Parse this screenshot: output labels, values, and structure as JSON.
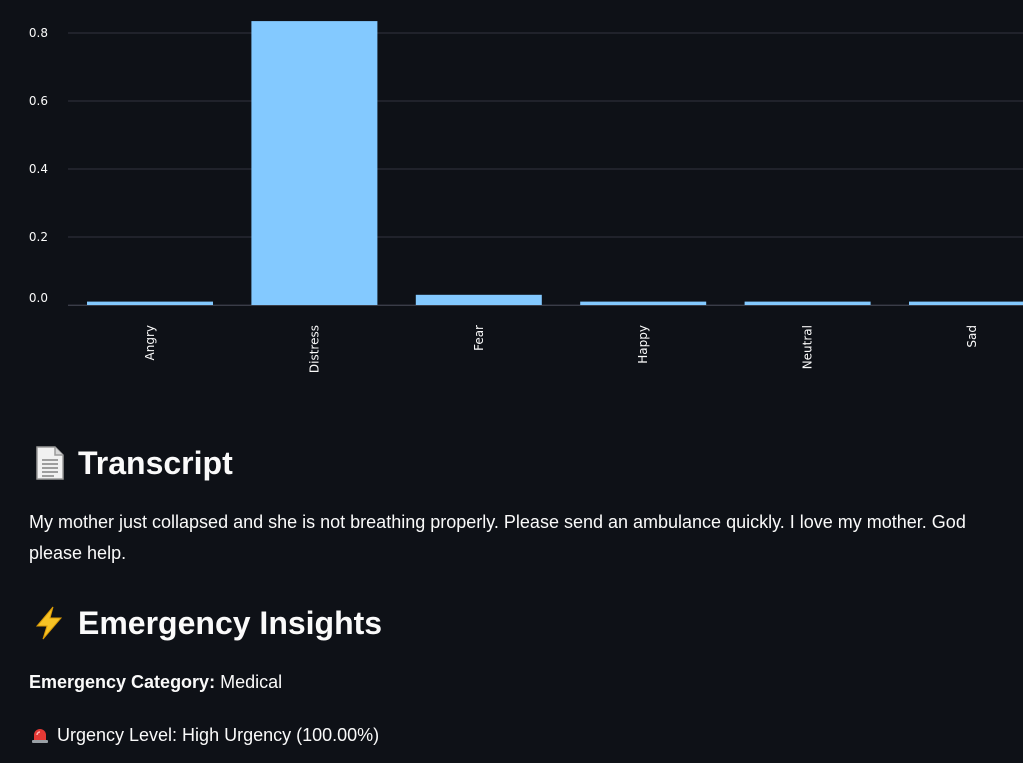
{
  "chart_data": {
    "type": "bar",
    "categories": [
      "Angry",
      "Distress",
      "Fear",
      "Happy",
      "Neutral",
      "Sad"
    ],
    "values": [
      0.01,
      0.835,
      0.03,
      0.01,
      0.01,
      0.01
    ],
    "yticks": [
      "0.0",
      "0.2",
      "0.4",
      "0.6",
      "0.8"
    ],
    "ylim": [
      0,
      0.88
    ],
    "grid": true,
    "bar_color": "#83c9ff"
  },
  "transcript": {
    "icon": "page-icon",
    "heading": "Transcript",
    "text": "My mother just collapsed and she is not breathing properly. Please send an ambulance quickly. I love my mother. God please help."
  },
  "insights": {
    "icon": "lightning-icon",
    "heading": "Emergency Insights",
    "category_label": "Emergency Category:",
    "category_value": "Medical",
    "urgency_icon": "siren-icon",
    "urgency_text": "Urgency Level: High Urgency (100.00%)"
  },
  "colors": {
    "background": "#0e1117",
    "text": "#fafafa",
    "bar": "#83c9ff",
    "grid": "#31333f"
  }
}
